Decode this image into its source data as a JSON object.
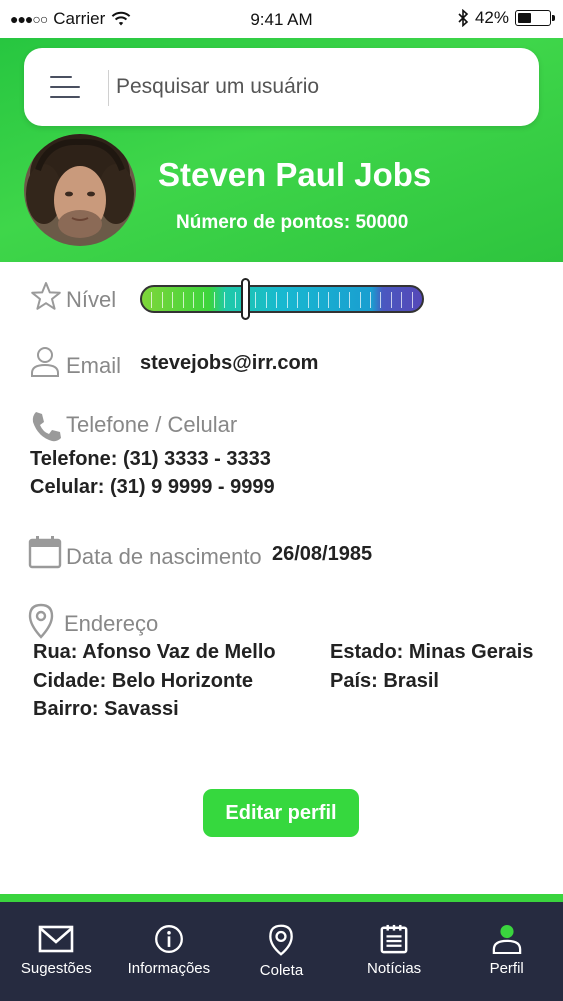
{
  "status_bar": {
    "signal": "●●●○○",
    "carrier": "Carrier",
    "time": "9:41 AM",
    "battery_percent": "42%",
    "battery_level": 0.42
  },
  "search": {
    "placeholder": "Pesquisar um usuário",
    "value": ""
  },
  "profile": {
    "name": "Steven Paul Jobs",
    "points_text": "Número de pontos: 50000",
    "level_label": "Nível",
    "level_value": 0.37,
    "email_label": "Email",
    "email": "stevejobs@irr.com",
    "phone_label": "Telefone / Celular",
    "phone": "Telefone: (31) 3333 - 3333",
    "mobile": "Celular: (31) 9 9999 - 9999",
    "birth_label": "Data de nascimento",
    "birth_date": "26/08/1985",
    "address_label": "Endereço",
    "street": "Rua: Afonso Vaz de Mello",
    "city": "Cidade: Belo Horizonte",
    "district": "Bairro: Savassi",
    "state": "Estado: Minas Gerais",
    "country": "País: Brasil"
  },
  "edit_button": "Editar perfil",
  "nav": [
    {
      "label": "Sugestões",
      "icon": "mail-icon"
    },
    {
      "label": "Informações",
      "icon": "info-icon"
    },
    {
      "label": "Coleta",
      "icon": "location-pin-icon"
    },
    {
      "label": "Notícias",
      "icon": "news-icon"
    },
    {
      "label": "Perfil",
      "icon": "person-icon",
      "active": true
    }
  ],
  "colors": {
    "primary_green": "#36d83e",
    "nav_background": "#262b40",
    "active_nav_icon": "#3ad43e"
  }
}
